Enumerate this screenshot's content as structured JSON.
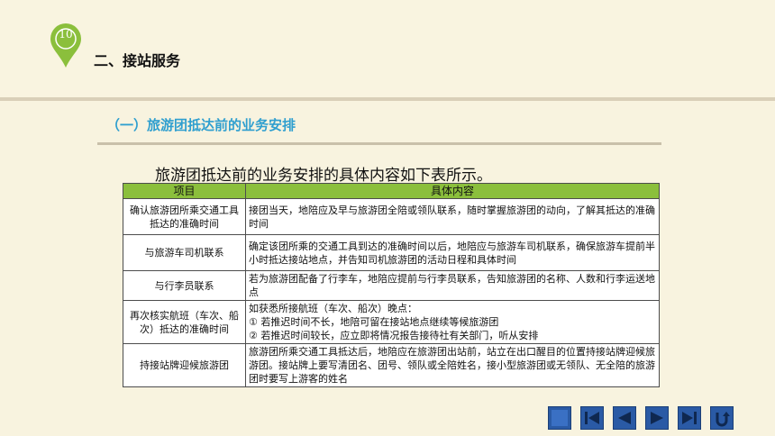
{
  "badge": {
    "number": "10",
    "color": "#8bbf3c"
  },
  "section": {
    "title": "二、接站服务"
  },
  "subsection": {
    "title": "（一）旅游团抵达前的业务安排"
  },
  "intro_text": "旅游团抵达前的业务安排的具体内容如下表所示。",
  "table": {
    "headers": [
      "项目",
      "具体内容"
    ],
    "rows": [
      {
        "item": "确认旅游团所乘交通工具抵达的准确时间",
        "content": [
          "接团当天，地陪应及早与旅游团全陪或领队联系，随时掌握旅游团的动向，了解其抵达的准确时间"
        ]
      },
      {
        "item": "与旅游车司机联系",
        "content": [
          "确定该团所乘的交通工具到达的准确时间以后，地陪应与旅游车司机联系，确保旅游车提前半小时抵达接站地点，并告知司机旅游团的活动日程和具体时间"
        ]
      },
      {
        "item": "与行李员联系",
        "content": [
          "若为旅游团配备了行李车，地陪应提前与行李员联系，告知旅游团的名称、人数和行李运送地点"
        ]
      },
      {
        "item": "再次核实航班（车次、船次）抵达的准确时间",
        "content": [
          "如获悉所接航班（车次、船次）晚点：",
          "① 若推迟时间不长，地陪可留在接站地点继续等候旅游团",
          "② 若推迟时间较长，应立即将情况报告接待社有关部门，听从安排"
        ]
      },
      {
        "item": "持接站牌迎候旅游团",
        "content": [
          "旅游团所乘交通工具抵达后，地陪应在旅游团出站前，站立在出口醒目的位置持接站牌迎候旅游团。接站牌上要写清团名、团号、领队或全陪姓名，接小型旅游团或无领队、无全陪的旅游团时要写上游客的姓名"
        ]
      }
    ]
  },
  "nav": {
    "buttons": [
      "home-icon",
      "first-page-icon",
      "previous-page-icon",
      "next-page-icon",
      "last-page-icon",
      "return-icon"
    ]
  }
}
